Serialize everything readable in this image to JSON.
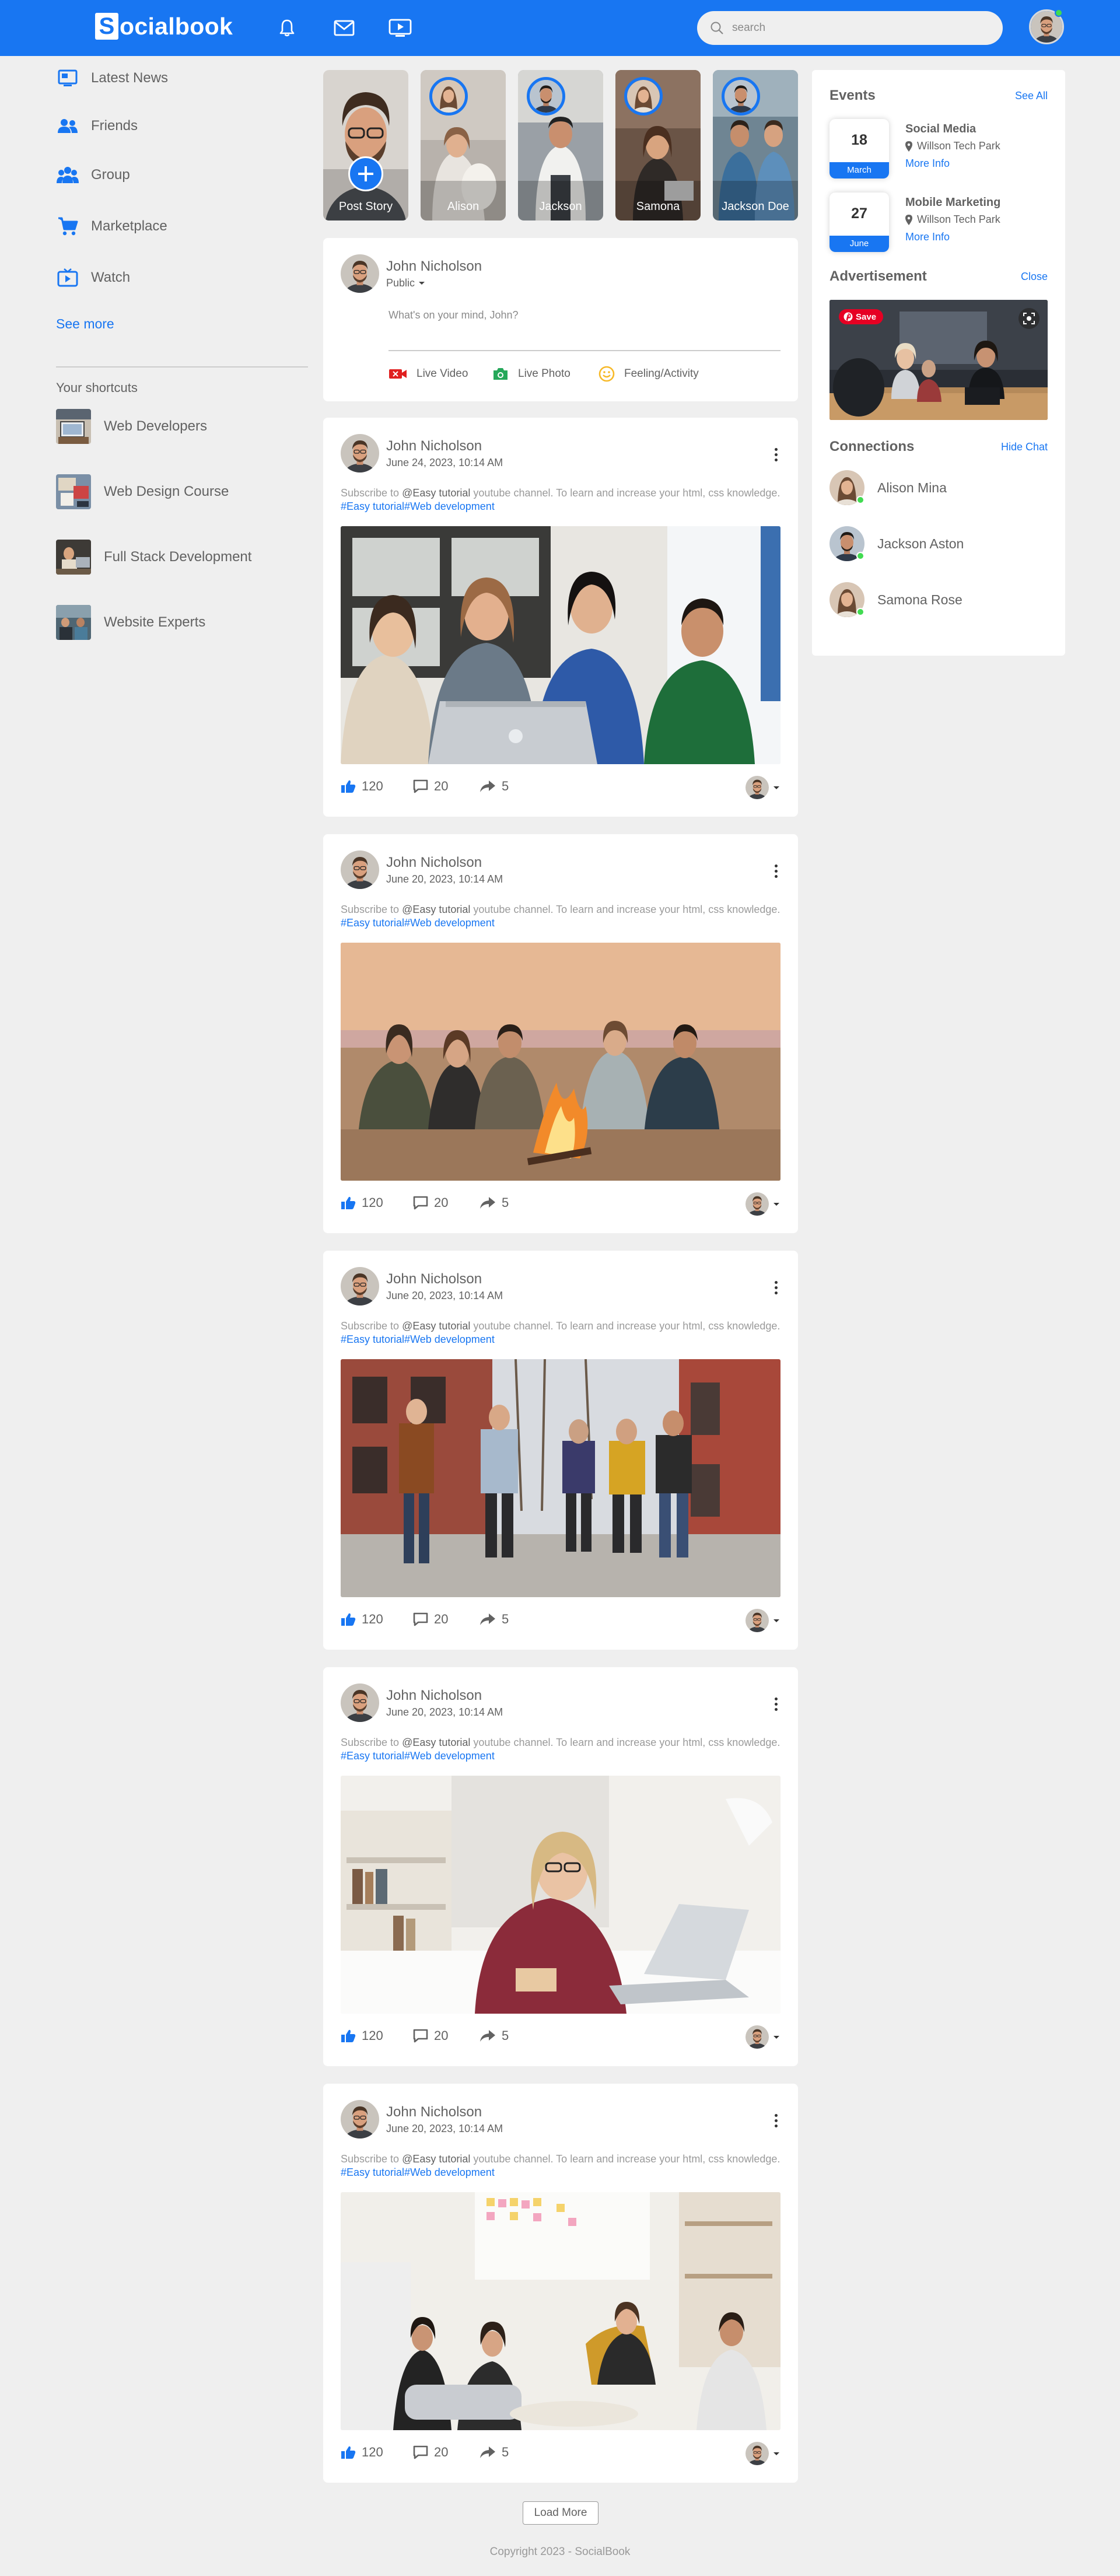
{
  "brand": {
    "logo_letter": "S",
    "logo_rest": "ocialbook",
    "accent": "#1876f2",
    "online": "#41db51"
  },
  "nav": {
    "icons": [
      "bell-icon",
      "envelope-icon",
      "video-play-icon"
    ],
    "search_placeholder": "search"
  },
  "sidebar": {
    "items": [
      {
        "label": "Latest News",
        "icon": "news-icon"
      },
      {
        "label": "Friends",
        "icon": "friends-icon"
      },
      {
        "label": "Group",
        "icon": "group-icon"
      },
      {
        "label": "Marketplace",
        "icon": "cart-icon"
      },
      {
        "label": "Watch",
        "icon": "tv-icon"
      }
    ],
    "see_more": "See more",
    "shortcuts_title": "Your shortcuts",
    "shortcuts": [
      {
        "label": "Web Developers"
      },
      {
        "label": "Web Design Course"
      },
      {
        "label": "Full Stack Development"
      },
      {
        "label": "Website Experts"
      }
    ]
  },
  "stories": [
    {
      "name": "Post Story"
    },
    {
      "name": "Alison"
    },
    {
      "name": "Jackson"
    },
    {
      "name": "Samona"
    },
    {
      "name": "Jackson Doe"
    }
  ],
  "composer": {
    "author": "John Nicholson",
    "privacy": "Public",
    "placeholder": "What's on your mind, John?",
    "actions": [
      {
        "label": "Live Video",
        "icon": "video-camera-icon"
      },
      {
        "label": "Live Photo",
        "icon": "photo-camera-icon"
      },
      {
        "label": "Feeling/Activity",
        "icon": "smiley-icon"
      }
    ]
  },
  "posts": [
    {
      "author": "John Nicholson",
      "date": "June 24, 2023, 10:14 AM",
      "text_before": "Subscribe to ",
      "mention": "@Easy tutorial",
      "text_after": " youtube channel. To learn and increase your html, css knowledge. ",
      "tags": "#Easy tutorial#Web development",
      "likes": "120",
      "comments": "20",
      "shares": "5"
    },
    {
      "author": "John Nicholson",
      "date": "June 20, 2023, 10:14 AM",
      "text_before": "Subscribe to ",
      "mention": "@Easy tutorial",
      "text_after": " youtube channel. To learn and increase your html, css knowledge. ",
      "tags": "#Easy tutorial#Web development",
      "likes": "120",
      "comments": "20",
      "shares": "5"
    },
    {
      "author": "John Nicholson",
      "date": "June 20, 2023, 10:14 AM",
      "text_before": "Subscribe to ",
      "mention": "@Easy tutorial",
      "text_after": " youtube channel. To learn and increase your html, css knowledge. ",
      "tags": "#Easy tutorial#Web development",
      "likes": "120",
      "comments": "20",
      "shares": "5"
    },
    {
      "author": "John Nicholson",
      "date": "June 20, 2023, 10:14 AM",
      "text_before": "Subscribe to ",
      "mention": "@Easy tutorial",
      "text_after": " youtube channel. To learn and increase your html, css knowledge. ",
      "tags": "#Easy tutorial#Web development",
      "likes": "120",
      "comments": "20",
      "shares": "5"
    },
    {
      "author": "John Nicholson",
      "date": "June 20, 2023, 10:14 AM",
      "text_before": "Subscribe to ",
      "mention": "@Easy tutorial",
      "text_after": " youtube channel. To learn and increase your html, css knowledge. ",
      "tags": "#Easy tutorial#Web development",
      "likes": "120",
      "comments": "20",
      "shares": "5"
    }
  ],
  "load_more": "Load More",
  "copyright": "Copyright 2023 - SocialBook",
  "right": {
    "events_title": "Events",
    "see_all": "See All",
    "events": [
      {
        "day": "18",
        "month": "March",
        "title": "Social Media",
        "location": "Willson Tech Park",
        "more": "More Info"
      },
      {
        "day": "27",
        "month": "June",
        "title": "Mobile Marketing",
        "location": "Willson Tech Park",
        "more": "More Info"
      }
    ],
    "ad_title": "Advertisement",
    "ad_close": "Close",
    "ad_save": "Save",
    "connections_title": "Connections",
    "hide_chat": "Hide Chat",
    "connections": [
      {
        "name": "Alison Mina"
      },
      {
        "name": "Jackson Aston"
      },
      {
        "name": "Samona Rose"
      }
    ]
  }
}
